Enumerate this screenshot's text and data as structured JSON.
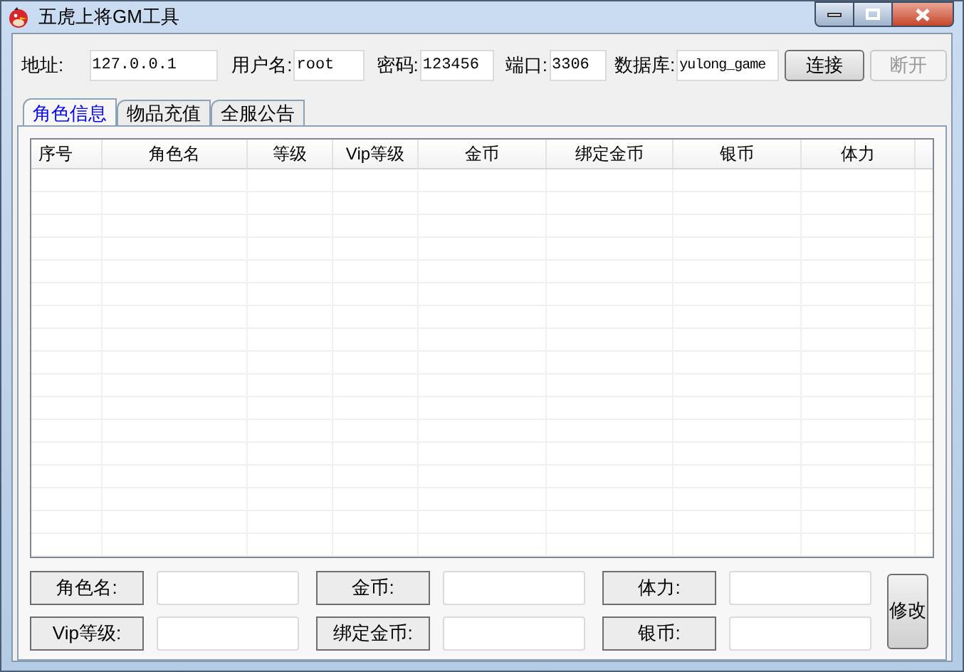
{
  "window": {
    "title": "五虎上将GM工具"
  },
  "connection": [
    {
      "label": "地址:",
      "value": "127.0.0.1"
    },
    {
      "label": "用户名:",
      "value": "root"
    },
    {
      "label": "密码:",
      "value": "123456"
    },
    {
      "label": "端口:",
      "value": "3306"
    },
    {
      "label": "数据库:",
      "value": "yulong_game"
    }
  ],
  "connection_buttons": [
    {
      "label": "连接",
      "disabled": false
    },
    {
      "label": "断开",
      "disabled": true
    }
  ],
  "tabs": [
    {
      "label": "角色信息",
      "selected": true
    },
    {
      "label": "物品充值",
      "selected": false
    },
    {
      "label": "全服公告",
      "selected": false
    }
  ],
  "table": {
    "columns": [
      "序号",
      "角色名",
      "等级",
      "Vip等级",
      "金币",
      "绑定金币",
      "银币",
      "体力"
    ]
  },
  "edit_form": {
    "fields": [
      {
        "label": "角色名:"
      },
      {
        "label": "金币:"
      },
      {
        "label": "体力:"
      },
      {
        "label": "Vip等级:"
      },
      {
        "label": "绑定金币:"
      },
      {
        "label": "银币:"
      }
    ],
    "submit": "修改"
  }
}
